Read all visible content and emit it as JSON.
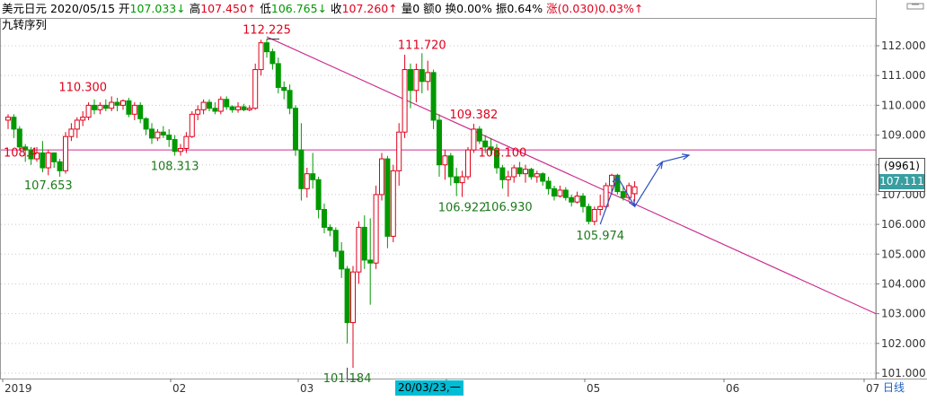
{
  "header": {
    "instrument": "美元日元",
    "date": "2020/05/15",
    "open_label": "开",
    "open": "107.033↓",
    "high_label": "高",
    "high": "107.450↑",
    "low_label": "低",
    "low": "106.765↓",
    "close_label": "收",
    "close": "107.260↑",
    "volume_label": "量",
    "volume": "0",
    "amount_label": "额",
    "amount": "0",
    "turnover_label": "换",
    "turnover": "0.00%",
    "amplitude_label": "振",
    "amplitude": "0.64%",
    "change_label": "涨",
    "change": "(0.030)0.03%↑"
  },
  "indicator_name": "九转序列",
  "price_badge": {
    "code": "(9961)",
    "value": "107.111"
  },
  "date_highlight": "20/03/23,一",
  "period_label": "日线",
  "colors": {
    "up": "#e0001b",
    "down": "#009900",
    "trendline": "#cc2e8f",
    "hline": "#cc2e8f",
    "arrow": "#2b4fc2",
    "grid": "#c8c8c8",
    "badge": "#3a9ea0"
  },
  "chart_data": {
    "type": "candlestick",
    "y_axis": {
      "min": 101,
      "max": 112,
      "ticks": [
        "101.000",
        "102.000",
        "103.000",
        "104.000",
        "105.000",
        "106.000",
        "107.000",
        "108.000",
        "109.000",
        "110.000",
        "111.000",
        "112.000"
      ],
      "position": "right",
      "grid": "dotted"
    },
    "x_axis": {
      "tick_labels": [
        "2019",
        "02",
        "03",
        "04",
        "05",
        "06",
        "07"
      ]
    },
    "candles": [
      {
        "o": 109.5,
        "h": 109.7,
        "l": 109.2,
        "c": 109.6
      },
      {
        "o": 109.6,
        "h": 109.7,
        "l": 108.9,
        "c": 109.2
      },
      {
        "o": 109.2,
        "h": 109.3,
        "l": 108.5,
        "c": 108.6
      },
      {
        "o": 108.6,
        "h": 108.7,
        "l": 108.1,
        "c": 108.5
      },
      {
        "o": 108.5,
        "h": 108.6,
        "l": 108.0,
        "c": 108.2
      },
      {
        "o": 108.2,
        "h": 108.6,
        "l": 108.1,
        "c": 108.4
      },
      {
        "o": 108.4,
        "h": 108.8,
        "l": 107.75,
        "c": 107.9
      },
      {
        "o": 107.9,
        "h": 108.5,
        "l": 107.65,
        "c": 108.4
      },
      {
        "o": 108.4,
        "h": 108.4,
        "l": 107.9,
        "c": 108.1
      },
      {
        "o": 108.1,
        "h": 108.2,
        "l": 107.6,
        "c": 107.8
      },
      {
        "o": 107.8,
        "h": 109.1,
        "l": 107.7,
        "c": 108.95
      },
      {
        "o": 108.95,
        "h": 109.4,
        "l": 108.8,
        "c": 109.2
      },
      {
        "o": 109.2,
        "h": 109.6,
        "l": 108.9,
        "c": 109.5
      },
      {
        "o": 109.5,
        "h": 109.8,
        "l": 109.3,
        "c": 109.6
      },
      {
        "o": 109.6,
        "h": 110.1,
        "l": 109.5,
        "c": 110.0
      },
      {
        "o": 110.0,
        "h": 110.2,
        "l": 109.7,
        "c": 109.85
      },
      {
        "o": 109.85,
        "h": 110.1,
        "l": 109.7,
        "c": 110.0
      },
      {
        "o": 110.0,
        "h": 110.2,
        "l": 109.8,
        "c": 109.9
      },
      {
        "o": 109.9,
        "h": 110.3,
        "l": 109.8,
        "c": 110.1
      },
      {
        "o": 110.1,
        "h": 110.25,
        "l": 109.8,
        "c": 110.0
      },
      {
        "o": 110.0,
        "h": 110.2,
        "l": 109.85,
        "c": 110.15
      },
      {
        "o": 110.15,
        "h": 110.25,
        "l": 109.6,
        "c": 109.7
      },
      {
        "o": 109.7,
        "h": 110.1,
        "l": 109.5,
        "c": 110.0
      },
      {
        "o": 110.0,
        "h": 110.1,
        "l": 109.4,
        "c": 109.55
      },
      {
        "o": 109.55,
        "h": 109.6,
        "l": 109.0,
        "c": 109.2
      },
      {
        "o": 109.2,
        "h": 109.4,
        "l": 108.7,
        "c": 108.9
      },
      {
        "o": 108.9,
        "h": 109.2,
        "l": 108.8,
        "c": 109.1
      },
      {
        "o": 109.1,
        "h": 109.3,
        "l": 108.9,
        "c": 109.0
      },
      {
        "o": 109.0,
        "h": 109.2,
        "l": 108.6,
        "c": 108.85
      },
      {
        "o": 108.85,
        "h": 109.0,
        "l": 108.31,
        "c": 108.45
      },
      {
        "o": 108.45,
        "h": 108.7,
        "l": 108.31,
        "c": 108.55
      },
      {
        "o": 108.55,
        "h": 109.1,
        "l": 108.4,
        "c": 108.95
      },
      {
        "o": 108.95,
        "h": 109.8,
        "l": 108.9,
        "c": 109.7
      },
      {
        "o": 109.7,
        "h": 110.0,
        "l": 109.5,
        "c": 109.85
      },
      {
        "o": 109.85,
        "h": 110.2,
        "l": 109.7,
        "c": 110.1
      },
      {
        "o": 110.1,
        "h": 110.2,
        "l": 109.8,
        "c": 109.9
      },
      {
        "o": 109.9,
        "h": 110.1,
        "l": 109.7,
        "c": 109.8
      },
      {
        "o": 109.8,
        "h": 110.3,
        "l": 109.7,
        "c": 110.2
      },
      {
        "o": 110.2,
        "h": 110.3,
        "l": 109.85,
        "c": 109.95
      },
      {
        "o": 109.95,
        "h": 110.0,
        "l": 109.75,
        "c": 109.85
      },
      {
        "o": 109.85,
        "h": 110.1,
        "l": 109.75,
        "c": 109.95
      },
      {
        "o": 109.95,
        "h": 110.05,
        "l": 109.8,
        "c": 109.85
      },
      {
        "o": 109.85,
        "h": 110.0,
        "l": 109.8,
        "c": 109.9
      },
      {
        "o": 109.9,
        "h": 111.4,
        "l": 109.85,
        "c": 111.2
      },
      {
        "o": 111.2,
        "h": 112.2,
        "l": 111.0,
        "c": 112.1
      },
      {
        "o": 112.1,
        "h": 112.23,
        "l": 111.6,
        "c": 111.8
      },
      {
        "o": 111.8,
        "h": 111.9,
        "l": 111.2,
        "c": 111.4
      },
      {
        "o": 111.4,
        "h": 111.6,
        "l": 110.4,
        "c": 110.6
      },
      {
        "o": 110.6,
        "h": 110.8,
        "l": 110.2,
        "c": 110.5
      },
      {
        "o": 110.5,
        "h": 110.7,
        "l": 109.7,
        "c": 109.9
      },
      {
        "o": 109.9,
        "h": 110.0,
        "l": 108.3,
        "c": 108.5
      },
      {
        "o": 108.5,
        "h": 109.4,
        "l": 106.8,
        "c": 107.2
      },
      {
        "o": 107.2,
        "h": 107.9,
        "l": 106.9,
        "c": 107.7
      },
      {
        "o": 107.7,
        "h": 108.4,
        "l": 107.2,
        "c": 107.5
      },
      {
        "o": 107.5,
        "h": 107.6,
        "l": 106.2,
        "c": 106.5
      },
      {
        "o": 106.5,
        "h": 106.7,
        "l": 105.7,
        "c": 105.9
      },
      {
        "o": 105.9,
        "h": 106.0,
        "l": 105.6,
        "c": 105.8
      },
      {
        "o": 105.8,
        "h": 105.9,
        "l": 104.9,
        "c": 105.1
      },
      {
        "o": 105.1,
        "h": 105.4,
        "l": 104.2,
        "c": 104.5
      },
      {
        "o": 104.5,
        "h": 104.6,
        "l": 102.0,
        "c": 102.7
      },
      {
        "o": 102.7,
        "h": 104.6,
        "l": 101.18,
        "c": 104.4
      },
      {
        "o": 104.4,
        "h": 106.1,
        "l": 104.0,
        "c": 105.9
      },
      {
        "o": 105.9,
        "h": 106.3,
        "l": 104.5,
        "c": 104.8
      },
      {
        "o": 104.8,
        "h": 106.2,
        "l": 103.3,
        "c": 104.7
      },
      {
        "o": 104.7,
        "h": 107.3,
        "l": 104.5,
        "c": 107.0
      },
      {
        "o": 107.0,
        "h": 108.4,
        "l": 106.8,
        "c": 108.2
      },
      {
        "o": 108.2,
        "h": 108.3,
        "l": 105.2,
        "c": 105.6
      },
      {
        "o": 105.6,
        "h": 108.0,
        "l": 105.4,
        "c": 107.8
      },
      {
        "o": 107.8,
        "h": 109.4,
        "l": 107.3,
        "c": 109.1
      },
      {
        "o": 109.1,
        "h": 111.7,
        "l": 108.9,
        "c": 111.2
      },
      {
        "o": 111.2,
        "h": 111.4,
        "l": 109.9,
        "c": 110.5
      },
      {
        "o": 110.5,
        "h": 111.4,
        "l": 110.1,
        "c": 111.2
      },
      {
        "o": 111.2,
        "h": 111.75,
        "l": 110.4,
        "c": 110.8
      },
      {
        "o": 110.8,
        "h": 111.5,
        "l": 110.5,
        "c": 111.1
      },
      {
        "o": 111.1,
        "h": 111.2,
        "l": 109.2,
        "c": 109.5
      },
      {
        "o": 109.5,
        "h": 109.7,
        "l": 107.6,
        "c": 108.0
      },
      {
        "o": 108.0,
        "h": 108.5,
        "l": 107.5,
        "c": 108.3
      },
      {
        "o": 108.3,
        "h": 108.4,
        "l": 107.3,
        "c": 107.6
      },
      {
        "o": 107.6,
        "h": 107.9,
        "l": 106.95,
        "c": 107.4
      },
      {
        "o": 107.4,
        "h": 107.8,
        "l": 106.92,
        "c": 107.6
      },
      {
        "o": 107.6,
        "h": 108.6,
        "l": 107.5,
        "c": 108.5
      },
      {
        "o": 108.5,
        "h": 109.38,
        "l": 108.4,
        "c": 109.2
      },
      {
        "o": 109.2,
        "h": 109.3,
        "l": 108.7,
        "c": 108.8
      },
      {
        "o": 108.8,
        "h": 109.0,
        "l": 108.4,
        "c": 108.6
      },
      {
        "o": 108.6,
        "h": 108.9,
        "l": 108.3,
        "c": 108.5
      },
      {
        "o": 108.5,
        "h": 108.7,
        "l": 107.7,
        "c": 107.9
      },
      {
        "o": 107.9,
        "h": 108.0,
        "l": 107.2,
        "c": 107.5
      },
      {
        "o": 107.5,
        "h": 107.8,
        "l": 106.93,
        "c": 107.6
      },
      {
        "o": 107.6,
        "h": 108.0,
        "l": 107.4,
        "c": 107.9
      },
      {
        "o": 107.9,
        "h": 108.1,
        "l": 107.6,
        "c": 107.7
      },
      {
        "o": 107.7,
        "h": 108.0,
        "l": 107.4,
        "c": 107.85
      },
      {
        "o": 107.85,
        "h": 107.9,
        "l": 107.5,
        "c": 107.6
      },
      {
        "o": 107.6,
        "h": 107.8,
        "l": 107.4,
        "c": 107.7
      },
      {
        "o": 107.7,
        "h": 107.75,
        "l": 107.3,
        "c": 107.45
      },
      {
        "o": 107.45,
        "h": 107.6,
        "l": 107.0,
        "c": 107.2
      },
      {
        "o": 107.2,
        "h": 107.3,
        "l": 106.8,
        "c": 106.95
      },
      {
        "o": 106.95,
        "h": 107.3,
        "l": 106.9,
        "c": 107.15
      },
      {
        "o": 107.15,
        "h": 107.25,
        "l": 106.8,
        "c": 106.9
      },
      {
        "o": 106.9,
        "h": 107.0,
        "l": 106.6,
        "c": 106.75
      },
      {
        "o": 106.75,
        "h": 107.1,
        "l": 106.7,
        "c": 106.95
      },
      {
        "o": 106.95,
        "h": 107.05,
        "l": 106.4,
        "c": 106.6
      },
      {
        "o": 106.6,
        "h": 106.7,
        "l": 106.0,
        "c": 106.1
      },
      {
        "o": 106.1,
        "h": 106.6,
        "l": 105.97,
        "c": 106.5
      },
      {
        "o": 106.5,
        "h": 107.0,
        "l": 106.3,
        "c": 106.6
      },
      {
        "o": 106.6,
        "h": 107.4,
        "l": 106.5,
        "c": 107.3
      },
      {
        "o": 107.3,
        "h": 107.7,
        "l": 107.0,
        "c": 107.65
      },
      {
        "o": 107.65,
        "h": 107.7,
        "l": 107.0,
        "c": 107.1
      },
      {
        "o": 107.1,
        "h": 107.3,
        "l": 106.8,
        "c": 106.9
      },
      {
        "o": 106.9,
        "h": 107.4,
        "l": 106.8,
        "c": 107.3
      },
      {
        "o": 107.03,
        "h": 107.45,
        "l": 106.77,
        "c": 107.26
      }
    ],
    "horizontal_line": 108.5,
    "trendline": {
      "from": {
        "index": 45,
        "price": 112.3
      },
      "to_price_at_right_edge": 103.0
    },
    "price_labels": [
      {
        "index": 45,
        "text": "112.225",
        "price": 112.225,
        "side": "high"
      },
      {
        "index": 13,
        "text": "110.300",
        "price": 110.3,
        "side": "high"
      },
      {
        "index": 7,
        "text": "107.653",
        "price": 107.653,
        "side": "low"
      },
      {
        "index": 29,
        "text": "108.313",
        "price": 108.313,
        "side": "low"
      },
      {
        "index": 72,
        "text": "111.720",
        "price": 111.72,
        "side": "high"
      },
      {
        "index": 81,
        "text": "109.382",
        "price": 109.382,
        "side": "high"
      },
      {
        "index": 59,
        "text": "101.184",
        "price": 101.184,
        "side": "low"
      },
      {
        "index": 79,
        "text": "106.922",
        "price": 106.922,
        "side": "low"
      },
      {
        "index": 87,
        "text": "106.930",
        "price": 106.93,
        "side": "low"
      },
      {
        "index": 86,
        "text": "108.100",
        "price": 108.1,
        "side": "high"
      },
      {
        "index": 103,
        "text": "105.974",
        "price": 105.974,
        "side": "low"
      },
      {
        "index": 0,
        "text": "108.4",
        "price": 108.4,
        "side": "left"
      }
    ]
  }
}
